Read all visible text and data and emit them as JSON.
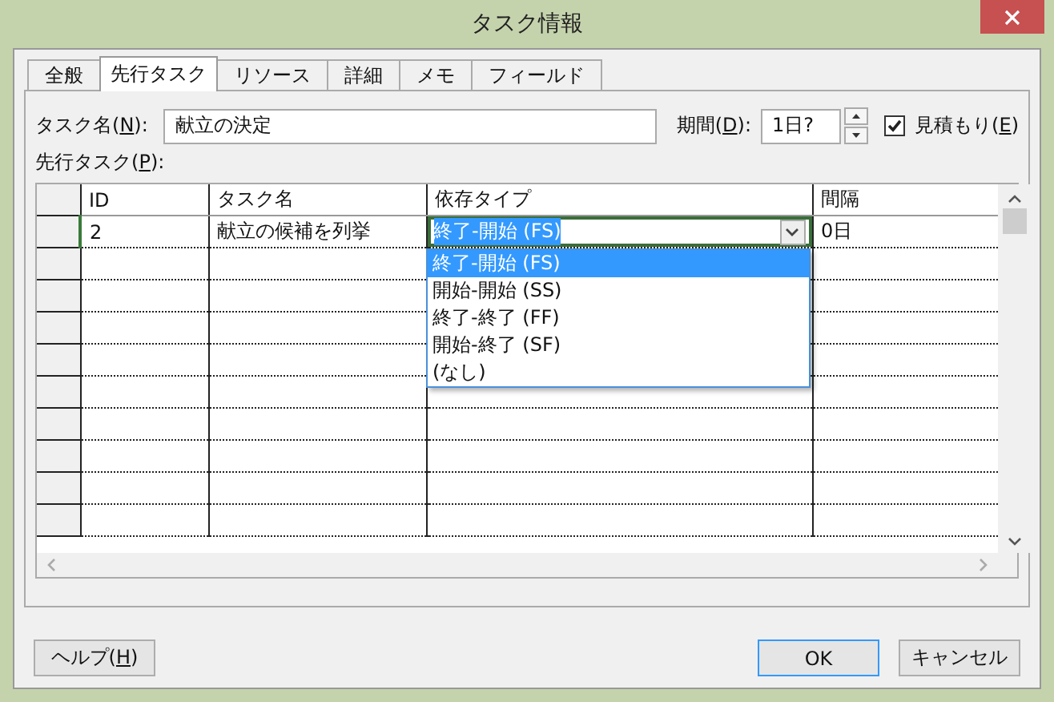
{
  "window": {
    "title": "タスク情報"
  },
  "tabs": [
    {
      "label": "全般",
      "selected": false
    },
    {
      "label": "先行タスク",
      "selected": true
    },
    {
      "label": "リソース",
      "selected": false
    },
    {
      "label": "詳細",
      "selected": false
    },
    {
      "label": "メモ",
      "selected": false
    },
    {
      "label": "フィールド",
      "selected": false
    }
  ],
  "task_name": {
    "label": {
      "before": "タスク名(",
      "key": "N",
      "after": "):"
    },
    "value": "献立の決定"
  },
  "duration": {
    "label": {
      "before": "期間(",
      "key": "D",
      "after": "):"
    },
    "value": "1日?"
  },
  "estimated": {
    "label": {
      "before": "見積もり(",
      "key": "E",
      "after": ")"
    },
    "checked": true
  },
  "predecessors": {
    "label": {
      "before": "先行タスク(",
      "key": "P",
      "after": "):"
    },
    "columns": [
      "ID",
      "タスク名",
      "依存タイプ",
      "間隔"
    ],
    "rows": [
      {
        "id": "2",
        "name": "献立の候補を列挙",
        "type": "終了-開始 (FS)",
        "lag": "0日"
      }
    ]
  },
  "dependency_dropdown": {
    "options": [
      {
        "label": "終了-開始 (FS)",
        "selected": true
      },
      {
        "label": "開始-開始 (SS)",
        "selected": false
      },
      {
        "label": "終了-終了 (FF)",
        "selected": false
      },
      {
        "label": "開始-終了 (SF)",
        "selected": false
      },
      {
        "label": "(なし)",
        "selected": false
      }
    ]
  },
  "buttons": {
    "help": {
      "before": "ヘルプ(",
      "key": "H",
      "after": ")"
    },
    "ok": "OK",
    "cancel": "キャンセル"
  }
}
